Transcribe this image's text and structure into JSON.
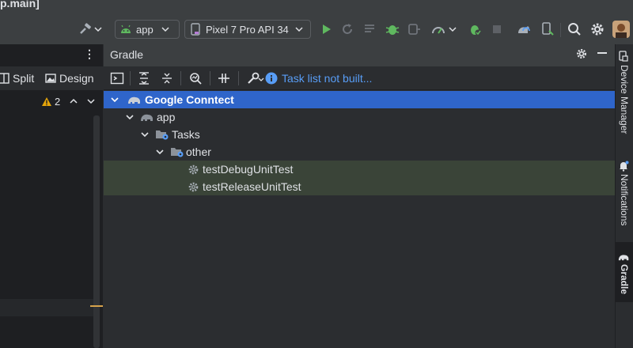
{
  "window": {
    "title_fragment": "p.main]"
  },
  "toolbar": {
    "config_label": "app",
    "device_label": "Pixel 7 Pro API 34",
    "icons": [
      "hammer-icon",
      "android-icon",
      "run-icon",
      "rerun-icon",
      "coverage-icon",
      "debug-icon",
      "attach-icon",
      "profiler-icon",
      "bug-sync-icon",
      "stop-icon",
      "gradle-sync-icon",
      "device-mirror-icon",
      "search-icon",
      "gear-icon",
      "avatar"
    ]
  },
  "editor": {
    "split_label": "Split",
    "design_label": "Design",
    "warning_count": "2"
  },
  "gradle": {
    "title": "Gradle",
    "status_text": "Task list not built...",
    "tree": [
      {
        "label": "Google Conntect",
        "depth": 0,
        "expanded": true,
        "selected": true,
        "icon": "elephant-icon"
      },
      {
        "label": "app",
        "depth": 1,
        "expanded": true,
        "icon": "elephant-icon"
      },
      {
        "label": "Tasks",
        "depth": 2,
        "expanded": true,
        "icon": "folder-gear-icon"
      },
      {
        "label": "other",
        "depth": 3,
        "expanded": true,
        "icon": "folder-gear-icon"
      },
      {
        "label": "testDebugUnitTest",
        "depth": 4,
        "icon": "gear-icon",
        "highlighted": true
      },
      {
        "label": "testReleaseUnitTest",
        "depth": 4,
        "icon": "gear-icon",
        "highlighted": true
      }
    ]
  },
  "side_stripe": {
    "device_manager": "Device Manager",
    "notifications": "Notifications",
    "gradle": "Gradle"
  },
  "colors": {
    "selection": "#2f65ca",
    "link": "#589df6",
    "run_green": "#5fb85f",
    "warning": "#e5a50a"
  }
}
